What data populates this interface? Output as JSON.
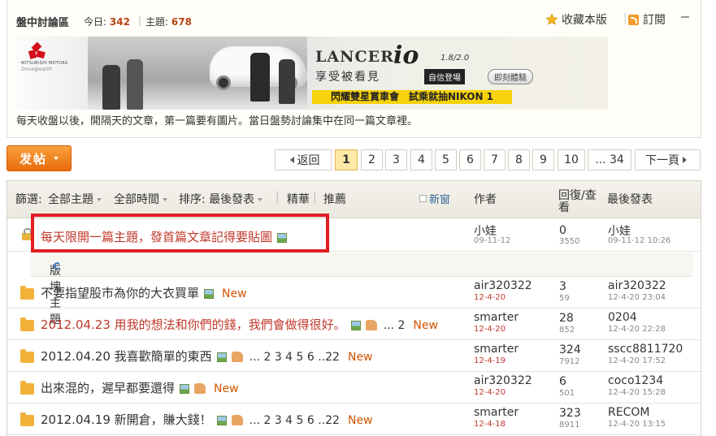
{
  "forum": {
    "title": "盤中討論區",
    "today_label": "今日:",
    "today_count": "342",
    "topics_label": "主題:",
    "topics_count": "678",
    "separator": "|",
    "favorite_label": "收藏本版",
    "subscribe_label": "訂閱",
    "notice": "每天收盤以後，開隔天的文章，第一篇要有圖片。當日盤勢討論集中在同一篇文章裡。"
  },
  "banner": {
    "brand_small": "MITSUBISHI MOTORS",
    "brand_tag": "Drive@earth",
    "model": "LANCER",
    "model_suffix": "io",
    "version": "1.8/2.0",
    "slogan": "享受被看見",
    "slogan_tag": "自信登場",
    "cta": "即刻體驗",
    "promo": "閃耀雙星賞車會　試乘就抽NIKON 1"
  },
  "toolbar": {
    "post_label": "发帖"
  },
  "pagination": {
    "prev": "返回",
    "pages": [
      "1",
      "2",
      "3",
      "4",
      "5",
      "6",
      "7",
      "8",
      "9",
      "10"
    ],
    "current": "1",
    "last": "... 34",
    "next": "下一頁"
  },
  "list_header": {
    "filter_label": "篩選:",
    "all_topics": "全部主題",
    "all_time": "全部時間",
    "sort_label": "排序: 最後發表",
    "digest": "精華",
    "recommended": "推薦",
    "new_window": "新窗",
    "author": "作者",
    "replies_views": "回復/查看",
    "last_post": "最後發表",
    "pipe": "|"
  },
  "pinned": {
    "title": "每天限開一篇主題，發首篇文章記得要貼圖",
    "author": "小娃",
    "author_date": "09-11-12",
    "replies": "0",
    "views": "3550",
    "last_author": "小娃",
    "last_date": "09-11-12 10:26"
  },
  "section_label": "版塊主題",
  "threads": [
    {
      "title": "不要指望股市為你的大衣買單",
      "red": false,
      "thumb": false,
      "pages": "",
      "new": "New",
      "author": "air320322",
      "author_date": "12-4-20",
      "replies": "3",
      "views": "59",
      "last_author": "air320322",
      "last_date": "12-4-20 23:04"
    },
    {
      "title": "2012.04.23 用我的想法和你們的錢，我們會做得很好。",
      "red": true,
      "thumb": true,
      "pages": "... 2",
      "new": "New",
      "author": "smarter",
      "author_date": "12-4-20",
      "replies": "28",
      "views": "852",
      "last_author": "0204",
      "last_date": "12-4-20 22:28"
    },
    {
      "title": "2012.04.20 我喜歡簡單的東西",
      "red": false,
      "thumb": true,
      "pages": "... 2 3 4 5 6 ..22",
      "new": "New",
      "author": "smarter",
      "author_date": "12-4-19",
      "replies": "324",
      "views": "7912",
      "last_author": "sscc8811720",
      "last_date": "12-4-20 17:52"
    },
    {
      "title": "出來混的，遲早都要還得",
      "red": false,
      "thumb": true,
      "pages": "",
      "new": "New",
      "author": "air320322",
      "author_date": "12-4-20",
      "replies": "6",
      "views": "501",
      "last_author": "coco1234",
      "last_date": "12-4-20 15:28"
    },
    {
      "title": "2012.04.19 新開倉，賺大錢！",
      "red": false,
      "thumb": true,
      "pages": "... 2 3 4 5 6 ..22",
      "new": "New",
      "author": "smarter",
      "author_date": "12-4-18",
      "replies": "323",
      "views": "8911",
      "last_author": "RECOM",
      "last_date": "12-4-20 13:15"
    }
  ]
}
